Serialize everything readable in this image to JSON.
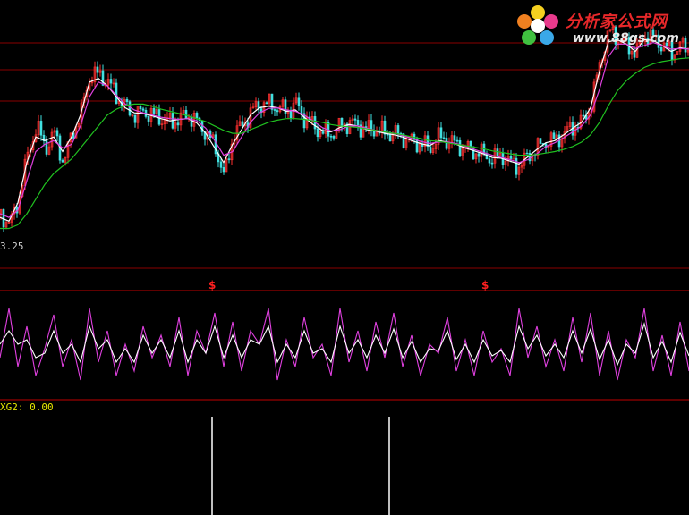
{
  "logo": {
    "brand": "分析家公式网",
    "url": "www.88gs.com",
    "icon": "flower-logo-icon"
  },
  "colors": {
    "background": "#000000",
    "up_candle": "#ff3030",
    "down_candle": "#40e0e0",
    "ma_short": "#ffffff",
    "ma_mid": "#e040e0",
    "ma_long": "#20c020",
    "divider": "#c00000",
    "osc_fast": "#e040e0",
    "osc_slow": "#ffffff",
    "signal": "#ffffff"
  },
  "chart_data": [
    {
      "type": "line",
      "panel": "price",
      "grid": true,
      "low_marker": "3.25",
      "ylim": [
        3.0,
        6.3
      ],
      "x": [
        0,
        10,
        20,
        30,
        40,
        50,
        60,
        70,
        80,
        90,
        100,
        110,
        120,
        130,
        140,
        150,
        160,
        170,
        180,
        190,
        200,
        210,
        220,
        230,
        240,
        250,
        260,
        270,
        280,
        290,
        300,
        310,
        320,
        330,
        340,
        350,
        360,
        370,
        380,
        390,
        400,
        410,
        420,
        430,
        440,
        450,
        460,
        470,
        480,
        490,
        500,
        510,
        520,
        530,
        540,
        550,
        560,
        570,
        580,
        590,
        600,
        610,
        620,
        630,
        640,
        650,
        660,
        670,
        680,
        690,
        700,
        710,
        720,
        730,
        740,
        750,
        760,
        770
      ],
      "close": [
        3.5,
        3.35,
        3.7,
        4.3,
        4.7,
        4.4,
        4.6,
        4.2,
        4.6,
        4.9,
        5.4,
        5.4,
        5.3,
        5.1,
        4.95,
        4.85,
        4.9,
        4.85,
        4.8,
        4.75,
        4.8,
        4.85,
        4.75,
        4.6,
        4.4,
        4.0,
        4.6,
        4.7,
        4.9,
        5.0,
        5.0,
        4.95,
        4.9,
        5.0,
        4.8,
        4.7,
        4.6,
        4.6,
        4.7,
        4.75,
        4.7,
        4.65,
        4.65,
        4.6,
        4.6,
        4.55,
        4.5,
        4.45,
        4.4,
        4.55,
        4.5,
        4.45,
        4.4,
        4.35,
        4.3,
        4.25,
        4.3,
        4.2,
        4.15,
        4.3,
        4.4,
        4.5,
        4.5,
        4.6,
        4.7,
        4.75,
        5.0,
        5.6,
        6.0,
        5.9,
        5.8,
        5.7,
        5.95,
        5.9,
        5.8,
        5.7,
        5.8,
        5.75
      ],
      "series": [
        {
          "name": "",
          "line": "ma_short",
          "values": [
            3.45,
            3.4,
            3.65,
            4.2,
            4.55,
            4.5,
            4.55,
            4.35,
            4.55,
            4.85,
            5.3,
            5.35,
            5.25,
            5.1,
            4.95,
            4.88,
            4.87,
            4.84,
            4.8,
            4.77,
            4.79,
            4.8,
            4.74,
            4.6,
            4.4,
            4.2,
            4.45,
            4.65,
            4.85,
            4.95,
            4.97,
            4.95,
            4.9,
            4.92,
            4.82,
            4.72,
            4.64,
            4.62,
            4.68,
            4.72,
            4.7,
            4.65,
            4.63,
            4.6,
            4.58,
            4.55,
            4.5,
            4.46,
            4.43,
            4.5,
            4.48,
            4.45,
            4.4,
            4.36,
            4.32,
            4.27,
            4.26,
            4.22,
            4.18,
            4.28,
            4.38,
            4.47,
            4.5,
            4.58,
            4.67,
            4.75,
            4.95,
            5.45,
            5.85,
            5.88,
            5.82,
            5.72,
            5.88,
            5.87,
            5.8,
            5.72,
            5.77,
            5.75
          ]
        },
        {
          "name": "",
          "line": "ma_mid",
          "values": [
            3.5,
            3.45,
            3.55,
            3.95,
            4.35,
            4.45,
            4.5,
            4.4,
            4.45,
            4.7,
            5.1,
            5.3,
            5.25,
            5.12,
            5.0,
            4.92,
            4.88,
            4.85,
            4.82,
            4.8,
            4.79,
            4.8,
            4.77,
            4.67,
            4.5,
            4.3,
            4.35,
            4.55,
            4.75,
            4.88,
            4.94,
            4.95,
            4.92,
            4.9,
            4.85,
            4.77,
            4.68,
            4.63,
            4.65,
            4.7,
            4.7,
            4.67,
            4.64,
            4.62,
            4.6,
            4.57,
            4.53,
            4.49,
            4.46,
            4.48,
            4.48,
            4.46,
            4.42,
            4.38,
            4.34,
            4.3,
            4.27,
            4.24,
            4.2,
            4.24,
            4.32,
            4.42,
            4.47,
            4.54,
            4.62,
            4.7,
            4.85,
            5.2,
            5.65,
            5.82,
            5.82,
            5.76,
            5.8,
            5.84,
            5.8,
            5.75,
            5.76,
            5.75
          ]
        },
        {
          "name": "",
          "line": "ma_long",
          "values": [
            3.3,
            3.3,
            3.35,
            3.5,
            3.7,
            3.9,
            4.05,
            4.15,
            4.25,
            4.4,
            4.55,
            4.7,
            4.85,
            4.93,
            4.98,
            5.0,
            5.0,
            4.97,
            4.93,
            4.9,
            4.87,
            4.84,
            4.8,
            4.76,
            4.7,
            4.64,
            4.6,
            4.6,
            4.65,
            4.7,
            4.75,
            4.78,
            4.8,
            4.8,
            4.79,
            4.77,
            4.75,
            4.72,
            4.7,
            4.69,
            4.68,
            4.66,
            4.64,
            4.62,
            4.6,
            4.58,
            4.55,
            4.53,
            4.5,
            4.49,
            4.47,
            4.45,
            4.43,
            4.41,
            4.39,
            4.36,
            4.34,
            4.32,
            4.3,
            4.3,
            4.31,
            4.33,
            4.35,
            4.38,
            4.42,
            4.48,
            4.58,
            4.75,
            4.98,
            5.18,
            5.32,
            5.42,
            5.5,
            5.55,
            5.58,
            5.6,
            5.62,
            5.63
          ]
        }
      ]
    },
    {
      "type": "line",
      "panel": "oscillator",
      "signal_marker": "$",
      "signal_marker_x": [
        237,
        542
      ],
      "grid": false,
      "ylim": [
        0,
        100
      ],
      "x": [
        0,
        10,
        20,
        30,
        40,
        50,
        60,
        70,
        80,
        90,
        100,
        110,
        120,
        130,
        140,
        150,
        160,
        170,
        180,
        190,
        200,
        210,
        220,
        230,
        240,
        250,
        260,
        270,
        280,
        290,
        300,
        310,
        320,
        330,
        340,
        350,
        360,
        370,
        380,
        390,
        400,
        410,
        420,
        430,
        440,
        450,
        460,
        470,
        480,
        490,
        500,
        510,
        520,
        530,
        540,
        550,
        560,
        570,
        580,
        590,
        600,
        610,
        620,
        630,
        640,
        650,
        660,
        670,
        680,
        690,
        700,
        710,
        720,
        730,
        740,
        750,
        760,
        770
      ],
      "series": [
        {
          "name": "",
          "line": "osc_fast",
          "values": [
            40,
            95,
            30,
            75,
            20,
            50,
            88,
            30,
            60,
            15,
            95,
            35,
            70,
            20,
            55,
            25,
            75,
            40,
            65,
            30,
            85,
            20,
            70,
            45,
            90,
            30,
            80,
            25,
            70,
            55,
            95,
            15,
            60,
            30,
            85,
            40,
            55,
            20,
            95,
            35,
            70,
            25,
            80,
            40,
            90,
            30,
            65,
            20,
            55,
            45,
            85,
            25,
            60,
            20,
            70,
            35,
            50,
            20,
            95,
            40,
            75,
            30,
            60,
            25,
            85,
            35,
            90,
            20,
            70,
            15,
            60,
            40,
            95,
            25,
            65,
            20,
            80,
            25
          ]
        },
        {
          "name": "",
          "line": "osc_slow",
          "values": [
            55,
            70,
            55,
            60,
            40,
            45,
            70,
            45,
            55,
            35,
            75,
            50,
            60,
            35,
            50,
            35,
            65,
            45,
            60,
            40,
            70,
            35,
            60,
            45,
            75,
            40,
            65,
            40,
            60,
            55,
            75,
            35,
            55,
            40,
            70,
            45,
            50,
            35,
            75,
            45,
            60,
            40,
            65,
            45,
            72,
            40,
            58,
            35,
            50,
            48,
            70,
            38,
            55,
            35,
            60,
            42,
            48,
            35,
            75,
            50,
            65,
            42,
            55,
            40,
            70,
            45,
            72,
            38,
            60,
            32,
            55,
            45,
            78,
            40,
            58,
            35,
            68,
            42
          ]
        }
      ]
    },
    {
      "type": "bar",
      "panel": "signal",
      "title": "XG2: 0.00",
      "ylim": [
        0,
        1
      ],
      "x": [
        237,
        435
      ],
      "values": [
        1,
        1
      ]
    }
  ]
}
